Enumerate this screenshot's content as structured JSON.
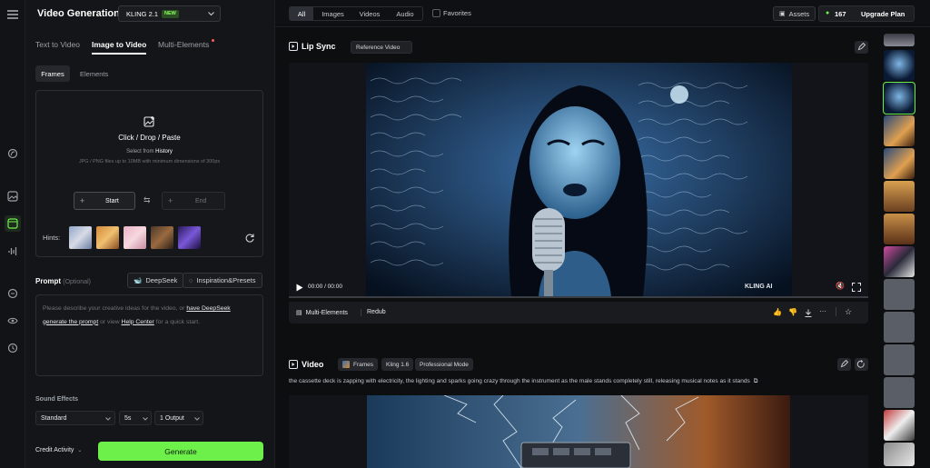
{
  "app": {
    "title": "Video Generation",
    "model": "KLING 2.1",
    "model_badge": "NEW"
  },
  "tabs": [
    {
      "label": "Text to Video"
    },
    {
      "label": "Image to Video"
    },
    {
      "label": "Multi-Elements"
    }
  ],
  "subtabs": [
    {
      "label": "Frames"
    },
    {
      "label": "Elements"
    }
  ],
  "upload": {
    "title": "Click / Drop / Paste",
    "select_prefix": "Select from",
    "select_link": "History",
    "hint": "JPG / PNG files up to 10MB with minimum dimensions of 300px",
    "start_label": "Start",
    "end_label": "End",
    "hints_label": "Hints:"
  },
  "prompt": {
    "label": "Prompt",
    "optional": "(Optional)",
    "deepseek": "DeepSeek",
    "inspiration": "Inspiration&Presets",
    "placeholder_1": "Please describe your creative ideas for the video, or",
    "placeholder_link1": "have DeepSeek generate the prompt",
    "placeholder_2": "or view",
    "placeholder_link2": "Help Center",
    "placeholder_3": "for a quick start."
  },
  "sound_effects": {
    "label": "Sound Effects"
  },
  "settings": {
    "mode": "Standard",
    "duration": "5s",
    "outputs": "1 Output"
  },
  "footer": {
    "credit": "Credit Activity",
    "generate": "Generate"
  },
  "topbar": {
    "filters": [
      "All",
      "Images",
      "Videos",
      "Audio"
    ],
    "favorites": "Favorites",
    "assets": "Assets",
    "credits": "167",
    "upgrade": "Upgrade Plan"
  },
  "card1": {
    "title": "Lip Sync",
    "chip": "Reference Video",
    "time": "00:00 / 00:00",
    "watermark": "KLING AI",
    "toolbar": [
      "Multi-Elements",
      "Redub"
    ]
  },
  "card2": {
    "title": "Video",
    "chips": [
      "Frames",
      "Kling 1.6",
      "Professional Mode"
    ],
    "prompt": "the cassette deck is zapping with electricity, the lighting and sparks going crazy through the instrument as the male stands completely still, releasing musical notes as it stands"
  },
  "colors": {
    "accent": "#6df04a",
    "bg": "#0d0e10",
    "panel": "#141518"
  }
}
